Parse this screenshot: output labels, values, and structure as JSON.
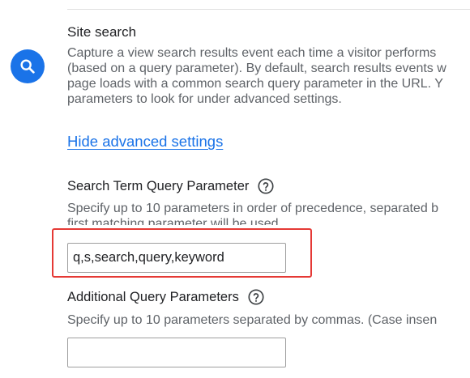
{
  "section": {
    "title": "Site search",
    "icon": "search-icon",
    "description_lines": [
      "Capture a view search results event each time a visitor performs",
      "(based on a query parameter). By default, search results events w",
      "page loads with a common search query parameter in the URL. Y",
      "parameters to look for under advanced settings."
    ]
  },
  "advanced_link": "Hide advanced settings",
  "search_term_param": {
    "label": "Search Term Query Parameter",
    "hint_lines": [
      "Specify up to 10 parameters in order of precedence, separated b",
      "first matching parameter will be used."
    ],
    "value": "q,s,search,query,keyword"
  },
  "additional_params": {
    "label": "Additional Query Parameters",
    "hint": "Specify up to 10 parameters separated by commas. (Case insen",
    "value": ""
  },
  "colors": {
    "accent": "#1a73e8",
    "highlight": "#e53935",
    "secondary_text": "#5f6368"
  }
}
